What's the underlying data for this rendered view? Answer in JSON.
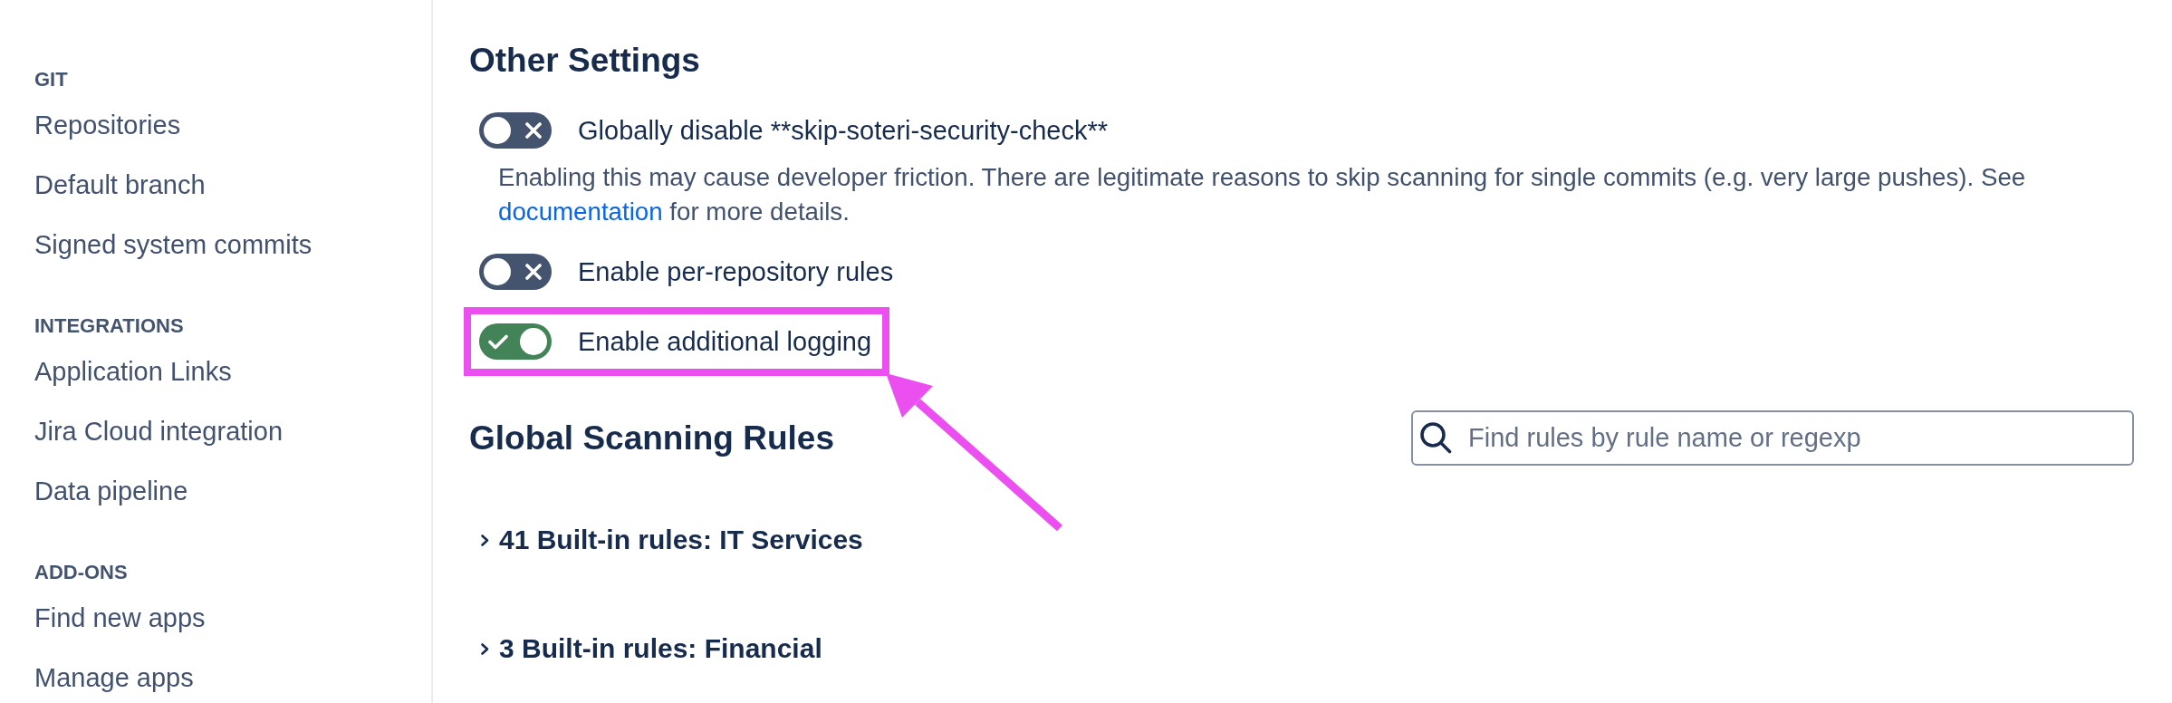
{
  "sidebar": {
    "sections": [
      {
        "heading": "GIT",
        "items": [
          {
            "label": "Repositories",
            "selected": false
          },
          {
            "label": "Default branch",
            "selected": false
          },
          {
            "label": "Signed system commits",
            "selected": false
          }
        ]
      },
      {
        "heading": "INTEGRATIONS",
        "items": [
          {
            "label": "Application Links",
            "selected": false
          },
          {
            "label": "Jira Cloud integration",
            "selected": false
          },
          {
            "label": "Data pipeline",
            "selected": false
          }
        ]
      },
      {
        "heading": "ADD-ONS",
        "items": [
          {
            "label": "Find new apps",
            "selected": false
          },
          {
            "label": "Manage apps",
            "selected": false
          }
        ]
      }
    ]
  },
  "other_settings": {
    "title": "Other Settings",
    "settings": [
      {
        "label": "Globally disable **skip-soteri-security-check**",
        "on": false,
        "highlighted": false,
        "description": {
          "text": "Enabling this may cause developer friction. There are legitimate reasons to skip scanning for single commits (e.g. very large pushes). See",
          "link": "documentation",
          "text_after": "for more details."
        }
      },
      {
        "label": "Enable per-repository rules",
        "on": false,
        "highlighted": false
      },
      {
        "label": "Enable additional logging",
        "on": true,
        "highlighted": true
      }
    ]
  },
  "global_scanning_rules": {
    "title": "Global Scanning Rules",
    "search": {
      "placeholder": "Find rules by rule name or regexp"
    },
    "rule_groups": [
      {
        "title": "41 Built-in rules: IT Services",
        "expanded": false
      },
      {
        "title": "3 Built-in rules: Financial",
        "expanded": false
      }
    ]
  }
}
